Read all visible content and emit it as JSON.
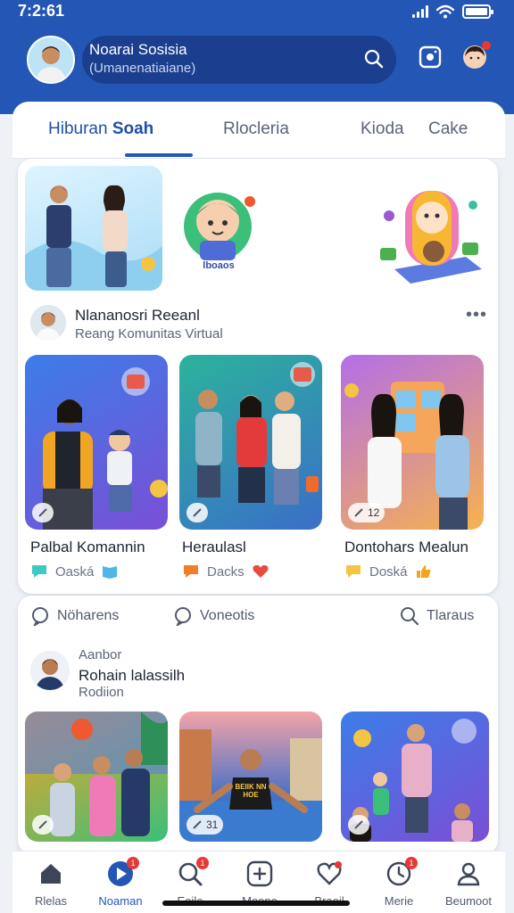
{
  "status": {
    "time": "7:2:61"
  },
  "header": {
    "search_title": "Noarai Sosisia",
    "search_subtitle": "(Umanenatiaiane)",
    "icons": [
      "search-icon",
      "camera-icon",
      "notification-avatar-icon"
    ],
    "colors": {
      "primary": "#2456b5",
      "badge": "#e53935"
    }
  },
  "tabs": [
    {
      "label": "Hiburan",
      "label_strong": "Soah"
    },
    {
      "label": "Rlocleria"
    },
    {
      "label": "Kioda"
    },
    {
      "label": "Cake"
    }
  ],
  "post1": {
    "title": "Nlananosri Reeanl",
    "subtitle": "Reang Komunitas Virtual",
    "sticker_caption": "lboaos"
  },
  "tiles1": [
    {
      "title": "Palbal Komannin",
      "meta": "Oaská",
      "badge": ""
    },
    {
      "title": "Heraulasl",
      "meta": "Dacks",
      "badge": ""
    },
    {
      "title": "Dontohars Mealun",
      "meta": "Doská",
      "badge": "12"
    }
  ],
  "actions": [
    {
      "label": "Nöharens",
      "icon": "comment-icon"
    },
    {
      "label": "Voneotis",
      "icon": "comment-icon"
    },
    {
      "label": "Tlaraus",
      "icon": "search-icon"
    }
  ],
  "post2": {
    "line1": "Aanbor",
    "title": "Rohain lalassilh",
    "line3": "Rodiion"
  },
  "tiles2": [
    {
      "badge": ""
    },
    {
      "badge": "31",
      "banner": "BEIIK NN HOE"
    },
    {
      "badge": ""
    }
  ],
  "nav": [
    {
      "label": "Rlelas",
      "icon": "home-icon",
      "badge": ""
    },
    {
      "label": "Noaman",
      "icon": "play-icon",
      "badge": "1"
    },
    {
      "label": "Eoile",
      "icon": "search-icon",
      "badge": "1"
    },
    {
      "label": "Moono",
      "icon": "add-icon",
      "badge": ""
    },
    {
      "label": "Braoil",
      "icon": "heart-icon",
      "badge": ""
    },
    {
      "label": "Merie",
      "icon": "clock-icon",
      "badge": "1"
    },
    {
      "label": "Beumoot",
      "icon": "profile-icon",
      "badge": ""
    }
  ]
}
